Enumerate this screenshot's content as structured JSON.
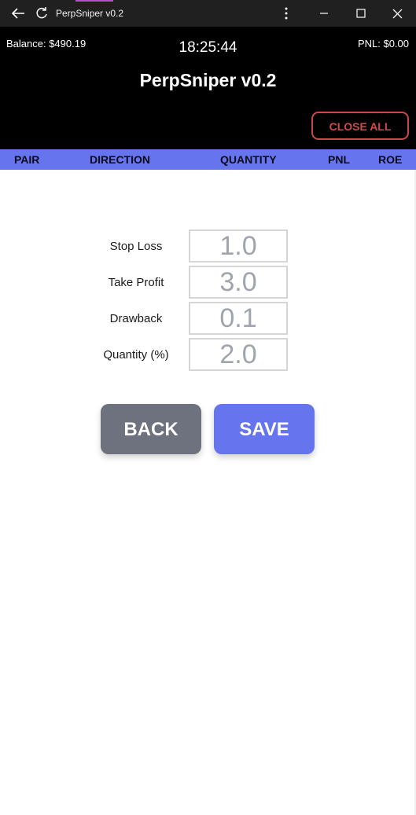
{
  "window": {
    "title": "PerpSniper v0.2",
    "icons": [
      "back-arrow-icon",
      "refresh-icon",
      "more-vertical-icon",
      "minimize-icon",
      "maximize-icon",
      "close-icon"
    ],
    "accent_color": "#b14fd3"
  },
  "header": {
    "balance": "Balance: $490.19",
    "time": "18:25:44",
    "pnl": "PNL: $0.00",
    "app_title": "PerpSniper v0.2",
    "close_all_label": "CLOSE ALL"
  },
  "table": {
    "columns": [
      "PAIR",
      "DIRECTION",
      "QUANTITY",
      "PNL",
      "ROE"
    ],
    "header_color": "#6674ee"
  },
  "settings": {
    "fields": [
      {
        "label": "Stop Loss",
        "placeholder": "1.0"
      },
      {
        "label": "Take Profit",
        "placeholder": "3.0"
      },
      {
        "label": "Drawback",
        "placeholder": "0.1"
      },
      {
        "label": "Quantity (%)",
        "placeholder": "2.0"
      }
    ]
  },
  "actions": {
    "back_label": "BACK",
    "save_label": "SAVE"
  },
  "colors": {
    "danger": "#cf4a4a",
    "primary": "#6674ee",
    "secondary": "#6e727f"
  }
}
